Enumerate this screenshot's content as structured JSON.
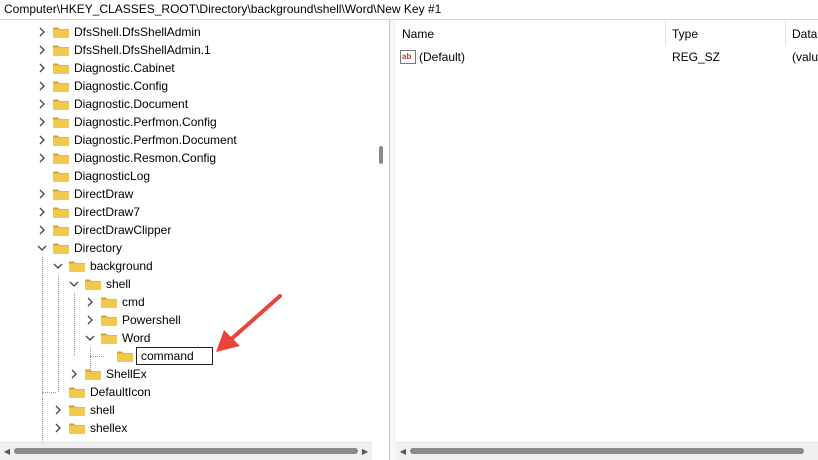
{
  "address_bar": {
    "path": "Computer\\HKEY_CLASSES_ROOT\\Directory\\background\\shell\\Word\\New Key #1"
  },
  "tree": {
    "items": [
      {
        "label": "DfsShell.DfsShellAdmin",
        "level": 0,
        "expander": "collapsed"
      },
      {
        "label": "DfsShell.DfsShellAdmin.1",
        "level": 0,
        "expander": "collapsed"
      },
      {
        "label": "Diagnostic.Cabinet",
        "level": 0,
        "expander": "collapsed"
      },
      {
        "label": "Diagnostic.Config",
        "level": 0,
        "expander": "collapsed"
      },
      {
        "label": "Diagnostic.Document",
        "level": 0,
        "expander": "collapsed"
      },
      {
        "label": "Diagnostic.Perfmon.Config",
        "level": 0,
        "expander": "collapsed"
      },
      {
        "label": "Diagnostic.Perfmon.Document",
        "level": 0,
        "expander": "collapsed"
      },
      {
        "label": "Diagnostic.Resmon.Config",
        "level": 0,
        "expander": "collapsed"
      },
      {
        "label": "DiagnosticLog",
        "level": 0,
        "expander": "none"
      },
      {
        "label": "DirectDraw",
        "level": 0,
        "expander": "collapsed"
      },
      {
        "label": "DirectDraw7",
        "level": 0,
        "expander": "collapsed"
      },
      {
        "label": "DirectDrawClipper",
        "level": 0,
        "expander": "collapsed"
      },
      {
        "label": "Directory",
        "level": 0,
        "expander": "expanded"
      },
      {
        "label": "background",
        "level": 1,
        "expander": "expanded"
      },
      {
        "label": "shell",
        "level": 2,
        "expander": "expanded"
      },
      {
        "label": "cmd",
        "level": 3,
        "expander": "collapsed"
      },
      {
        "label": "Powershell",
        "level": 3,
        "expander": "collapsed"
      },
      {
        "label": "Word",
        "level": 3,
        "expander": "expanded"
      },
      {
        "label": "command",
        "level": 4,
        "expander": "none",
        "editing": true
      },
      {
        "label": "ShellEx",
        "level": 2,
        "expander": "collapsed"
      },
      {
        "label": "DefaultIcon",
        "level": 1,
        "expander": "none"
      },
      {
        "label": "shell",
        "level": 1,
        "expander": "collapsed"
      },
      {
        "label": "shellex",
        "level": 1,
        "expander": "collapsed"
      }
    ]
  },
  "values_list": {
    "columns": {
      "name": "Name",
      "type": "Type",
      "data": "Data"
    },
    "rows": [
      {
        "name": "(Default)",
        "type": "REG_SZ",
        "data": "(valu"
      }
    ]
  },
  "colors": {
    "folder": "#f2c94c",
    "folder_dark": "#d9a520",
    "annotation_arrow": "#e8453c",
    "scroll_thumb": "#8a8a8a"
  },
  "icons": {
    "folder": "folder-icon",
    "string_value": "string-value-icon"
  }
}
